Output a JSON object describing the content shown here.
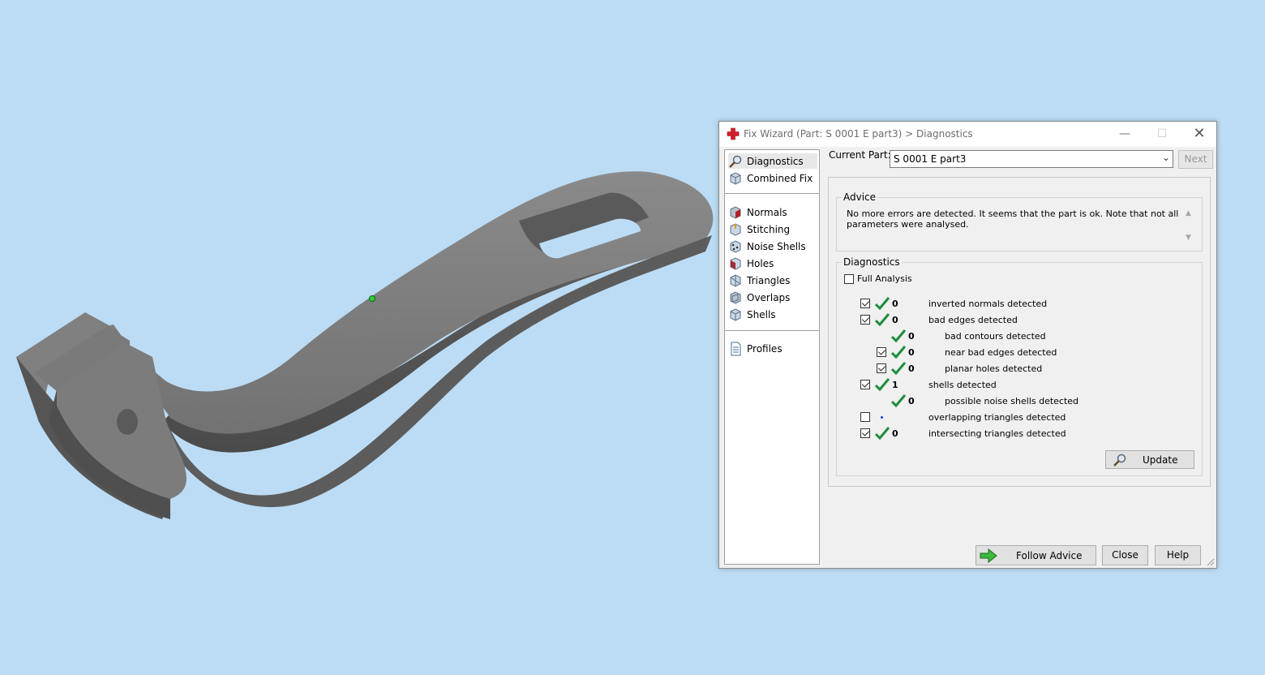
{
  "window": {
    "title": "Fix Wizard (Part: S 0001 E part3) > Diagnostics"
  },
  "nav": {
    "items": [
      {
        "label": "Diagnostics",
        "icon": "magnifier-icon"
      },
      {
        "label": "Combined Fix",
        "icon": "cube-icon"
      },
      {
        "label": "Normals",
        "icon": "normals-cube-icon"
      },
      {
        "label": "Stitching",
        "icon": "stitching-cube-icon"
      },
      {
        "label": "Noise Shells",
        "icon": "noise-shells-icon"
      },
      {
        "label": "Holes",
        "icon": "holes-cube-icon"
      },
      {
        "label": "Triangles",
        "icon": "triangles-cube-icon"
      },
      {
        "label": "Overlaps",
        "icon": "overlaps-cube-icon"
      },
      {
        "label": "Shells",
        "icon": "shells-cube-icon"
      },
      {
        "label": "Profiles",
        "icon": "document-icon"
      }
    ],
    "selected": "Diagnostics"
  },
  "current_part": {
    "label": "Current Part:",
    "value": "S 0001 E part3",
    "next_label": "Next"
  },
  "advice": {
    "title": "Advice",
    "text": "No more errors are detected. It seems that the part is ok. Note that not all parameters were analysed."
  },
  "diagnostics": {
    "title": "Diagnostics",
    "full_analysis_label": "Full Analysis",
    "full_analysis_checked": false,
    "rows": [
      {
        "checkbox": true,
        "checked": true,
        "status": "ok",
        "count": "0",
        "label": "inverted normals detected"
      },
      {
        "checkbox": true,
        "checked": true,
        "status": "ok",
        "count": "0",
        "label": "bad edges detected"
      },
      {
        "checkbox": false,
        "checked": false,
        "status": "ok",
        "count": "0",
        "label": "bad contours detected"
      },
      {
        "checkbox": true,
        "checked": true,
        "status": "ok",
        "count": "0",
        "label": "near bad edges detected"
      },
      {
        "checkbox": true,
        "checked": true,
        "status": "ok",
        "count": "0",
        "label": "planar holes detected"
      },
      {
        "checkbox": true,
        "checked": true,
        "status": "ok",
        "count": "1",
        "label": "shells detected"
      },
      {
        "checkbox": false,
        "checked": false,
        "status": "ok",
        "count": "0",
        "label": "possible noise shells detected"
      },
      {
        "checkbox": true,
        "checked": false,
        "status": "not-analysed",
        "count": "",
        "label": "overlapping triangles detected"
      },
      {
        "checkbox": true,
        "checked": true,
        "status": "ok",
        "count": "0",
        "label": "intersecting triangles detected"
      }
    ],
    "update_label": "Update"
  },
  "footer": {
    "follow_advice_label": "Follow Advice",
    "close_label": "Close",
    "help_label": "Help"
  },
  "colors": {
    "viewport_background": "#bcdcf5",
    "model": "#6e6e6e",
    "check_green": "#1e8c3a"
  }
}
